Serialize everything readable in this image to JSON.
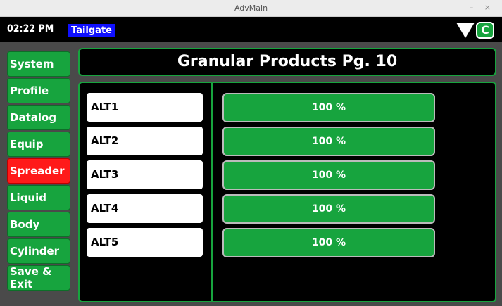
{
  "window": {
    "title": "AdvMain",
    "controls": "– ×"
  },
  "header": {
    "time": "02:22 PM",
    "badge": "Tailgate",
    "c_button": "C"
  },
  "nav": {
    "items": [
      {
        "label": "System"
      },
      {
        "label": "Profile"
      },
      {
        "label": "Datalog"
      },
      {
        "label": "Equip"
      },
      {
        "label": "Spreader"
      },
      {
        "label": "Liquid"
      },
      {
        "label": "Body"
      },
      {
        "label": "Cylinder"
      },
      {
        "label": "Save & Exit"
      }
    ],
    "active": "Spreader"
  },
  "page": {
    "title": "Granular Products Pg. 10"
  },
  "rows": [
    {
      "label": "ALT1",
      "value": "100 %"
    },
    {
      "label": "ALT2",
      "value": "100 %"
    },
    {
      "label": "ALT3",
      "value": "100 %"
    },
    {
      "label": "ALT4",
      "value": "100 %"
    },
    {
      "label": "ALT5",
      "value": "100 %"
    }
  ],
  "colors": {
    "accent": "#17a43e",
    "active": "#ff1a1a",
    "badge": "#1010ff",
    "background": "#000000"
  }
}
